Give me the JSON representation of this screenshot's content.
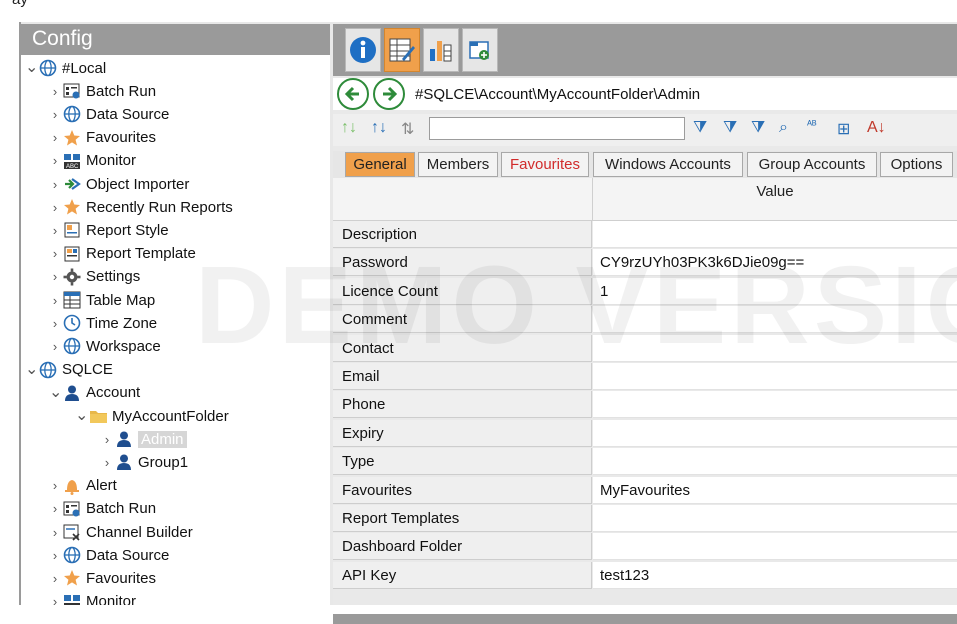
{
  "window": {
    "title_fragment": "ay"
  },
  "left_panel": {
    "title": "Config",
    "tree": [
      {
        "label": "#Local",
        "level": 0,
        "expanded": true,
        "icon": "globe-icon"
      },
      {
        "label": "Batch Run",
        "level": 1,
        "icon": "batch-run-icon"
      },
      {
        "label": "Data Source",
        "level": 1,
        "icon": "globe-icon"
      },
      {
        "label": "Favourites",
        "level": 1,
        "icon": "star-icon"
      },
      {
        "label": "Monitor",
        "level": 1,
        "icon": "monitor-icon"
      },
      {
        "label": "Object Importer",
        "level": 1,
        "icon": "importer-icon"
      },
      {
        "label": "Recently Run Reports",
        "level": 1,
        "icon": "star-icon"
      },
      {
        "label": "Report Style",
        "level": 1,
        "icon": "report-style-icon"
      },
      {
        "label": "Report Template",
        "level": 1,
        "icon": "report-template-icon"
      },
      {
        "label": "Settings",
        "level": 1,
        "icon": "gear-icon"
      },
      {
        "label": "Table Map",
        "level": 1,
        "icon": "table-map-icon"
      },
      {
        "label": "Time Zone",
        "level": 1,
        "icon": "clock-icon"
      },
      {
        "label": "Workspace",
        "level": 1,
        "icon": "globe-icon"
      },
      {
        "label": "SQLCE",
        "level": 0,
        "expanded": true,
        "icon": "globe-icon"
      },
      {
        "label": "Account",
        "level": 1,
        "expanded": true,
        "icon": "user-icon"
      },
      {
        "label": "MyAccountFolder",
        "level": 2,
        "expanded": true,
        "icon": "folder-icon"
      },
      {
        "label": "Admin",
        "level": 3,
        "selected": true,
        "icon": "user-icon"
      },
      {
        "label": "Group1",
        "level": 3,
        "icon": "user-icon"
      },
      {
        "label": "Alert",
        "level": 1,
        "icon": "bell-icon"
      },
      {
        "label": "Batch Run",
        "level": 1,
        "icon": "batch-run-icon"
      },
      {
        "label": "Channel Builder",
        "level": 1,
        "icon": "channel-builder-icon"
      },
      {
        "label": "Data Source",
        "level": 1,
        "icon": "globe-icon"
      },
      {
        "label": "Favourites",
        "level": 1,
        "icon": "star-icon"
      },
      {
        "label": "Monitor",
        "level": 1,
        "icon": "monitor-icon"
      }
    ]
  },
  "toolbar": {
    "buttons": [
      "info-icon",
      "table-edit-icon",
      "chart-icon",
      "new-tab-icon"
    ],
    "active_index": 1
  },
  "nav": {
    "path": "#SQLCE\\Account\\MyAccountFolder\\Admin"
  },
  "search": {
    "value": ""
  },
  "tabs": [
    {
      "label": "General",
      "active": true,
      "color": "#222222"
    },
    {
      "label": "Members",
      "active": false,
      "color": "#222222"
    },
    {
      "label": "Favourites",
      "active": false,
      "color": "#d12b2b"
    },
    {
      "label": "Windows Accounts",
      "active": false,
      "color": "#222222"
    },
    {
      "label": "Group Accounts",
      "active": false,
      "color": "#222222"
    },
    {
      "label": "Options",
      "active": false,
      "color": "#222222"
    }
  ],
  "grid": {
    "value_header": "Value",
    "rows": [
      {
        "key": "Description",
        "value": ""
      },
      {
        "key": "Password",
        "value": "CY9rzUYh03PK3k6DJie09g=="
      },
      {
        "key": "Licence Count",
        "value": "1"
      },
      {
        "key": "Comment",
        "value": ""
      },
      {
        "key": "Contact",
        "value": ""
      },
      {
        "key": "Email",
        "value": ""
      },
      {
        "key": "Phone",
        "value": ""
      },
      {
        "key": "Expiry",
        "value": ""
      },
      {
        "key": "Type",
        "value": ""
      },
      {
        "key": "Favourites",
        "value": "MyFavourites"
      },
      {
        "key": "Report Templates",
        "value": ""
      },
      {
        "key": "Dashboard Folder",
        "value": ""
      },
      {
        "key": "API Key",
        "value": "test123"
      }
    ]
  },
  "watermark": "DEMO VERSION",
  "colors": {
    "accent": "#f0a04b",
    "header_gray": "#9a9a9a",
    "nav_green": "#2e8b3a"
  }
}
